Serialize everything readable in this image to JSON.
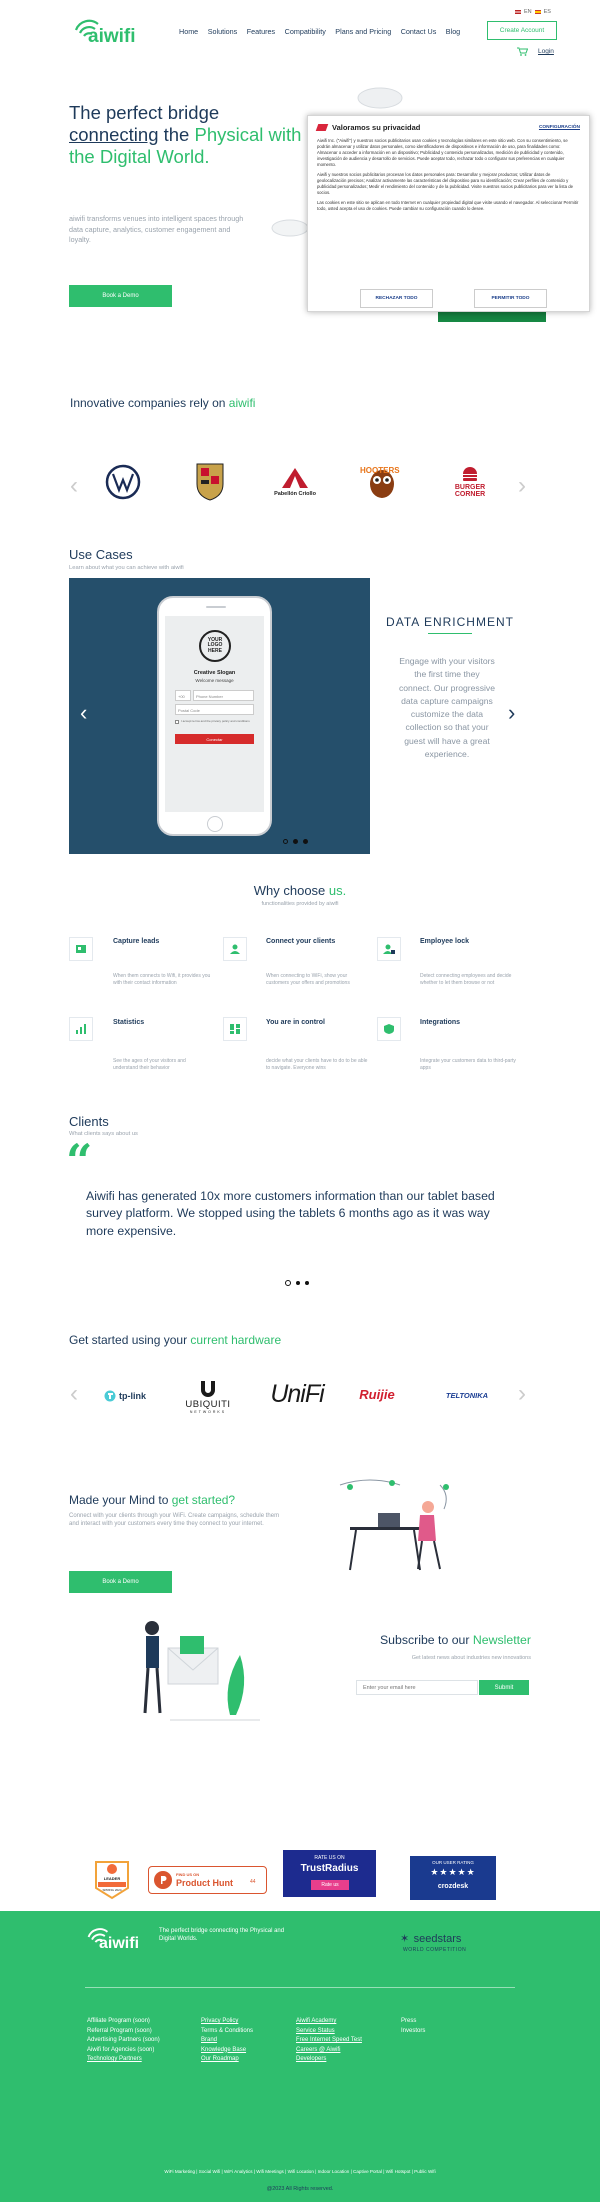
{
  "header": {
    "logo_text": "aiwifi",
    "lang": {
      "en": "EN",
      "es": "ES"
    },
    "nav": [
      "Home",
      "Solutions",
      "Features",
      "Compatibility",
      "Plans and Pricing",
      "Contact Us",
      "Blog"
    ],
    "create_account": "Create Account",
    "login": "Login"
  },
  "hero": {
    "title_line1": "The perfect bridge",
    "title_connecting": "connecting",
    "title_the": " the ",
    "title_physical": "Physical with",
    "title_line3": "the Digital World.",
    "description": "aiwifi transforms venues into intelligent spaces through data capture, analytics, customer engagement and loyalty.",
    "book_demo": "Book a Demo"
  },
  "cookie": {
    "title": "Valoramos su privacidad",
    "config": "CONFIGURACIÓN",
    "p1": "Aiwifi Inc. (\"Aiwifi\") y nuestros socios publicitarios usan cookies y tecnologías similares en este sitio web. Con su consentimiento, se podrán almacenar y utilizar datos personales, como identificadores de dispositivos e información de uso, para finalidades como: Almacenar o acceder a información en un dispositivo; Publicidad y contenido personalizados, medición de publicidad y contenido, investigación de audiencia y desarrollo de servicios. Puede aceptar todo, rechazar todo o configurar sus preferencias en cualquier momento.",
    "p2": "Aiwifi y nuestros socios publicitarios procesan los datos personales para: Desarrollar y mejorar productos; Utilizar datos de geolocalización precisos; Analizar activamente las características del dispositivo para su identificación; Crear perfiles de contenido y publicidad personalizados; Medir el rendimiento del contenido y de la publicidad. Visite nuestros socios publicitarios para ver la lista de socios.",
    "p3": "Las cookies en este sitio se aplican en todo Internet en cualquier propiedad digital que visite usando el navegador. Al seleccionar Permitir todo, usted acepta el uso de cookies. Puede cambiar su configuración cuando lo desee.",
    "reject": "RECHAZAR TODO",
    "accept": "PERMITIR TODO"
  },
  "companies": {
    "title_pre": "Innovative companies rely on ",
    "title_brand": "aiwifi",
    "logos": [
      "Volkswagen",
      "Porsche",
      "Pabellón Criollo",
      "Hooters",
      "Burger Corner"
    ]
  },
  "usecases": {
    "title": "Use Cases",
    "subtitle": "Learn about what you can achieve with aiwifi",
    "phone": {
      "logo": "YOUR LOGO HERE",
      "slogan": "Creative Slogan",
      "welcome": "Welcome message",
      "phone_prefix": "+00",
      "phone_placeholder": "Phone Number",
      "postal_placeholder": "Postal Code",
      "terms": "I accept terms and the privacy policy and conditions",
      "connect": "Conectar"
    },
    "slide_title": "DATA ENRICHMENT",
    "slide_text": "Engage with your visitors the first time they connect. Our progressive data capture campaigns customize the data collection so that your guest will have a great experience."
  },
  "why": {
    "title_pre": "Why choose ",
    "title_brand": "us.",
    "subtitle": "functionalities provided by aiwifi",
    "features": [
      {
        "title": "Capture leads",
        "desc": "When them connects to Wifi, it provides you with their contact information"
      },
      {
        "title": "Connect your clients",
        "desc": "When connecting to WiFi, show your customers your offers and promotions"
      },
      {
        "title": "Employee lock",
        "desc": "Detect connecting employees and decide whether to let them browse or not"
      },
      {
        "title": "Statistics",
        "desc": "See the ages of your visitors and understand their behavior"
      },
      {
        "title": "You are in control",
        "desc": "decide what your clients have to do to be able to navigate. Everyone wins"
      },
      {
        "title": "Integrations",
        "desc": "Integrate your customers data to third-party apps"
      }
    ]
  },
  "clients": {
    "title": "Clients",
    "subtitle": "What clients says about us",
    "quote": "Aiwifi has generated 10x more customers information than our tablet based survey platform. We stopped using the tablets 6 months ago as it was way more expensive."
  },
  "hardware": {
    "title_pre": "Get started using your ",
    "title_brand": "current hardware",
    "brands": [
      "tp-link",
      "UBIQUITI",
      "NETWORKS",
      "UniFi",
      "Ruijie",
      "TELTONIKA"
    ]
  },
  "mind": {
    "title_pre": "Made your Mind to ",
    "title_brand": "get started?",
    "desc": "Connect with your clients through your WiFi. Create campaigns, schedule them and interact with your customers every time they connect to your internet.",
    "book_demo": "Book a Demo"
  },
  "subscribe": {
    "title_pre": "Subscribe to our ",
    "title_brand": "Newsletter",
    "subtitle": "Get latest news about industries new innovations",
    "placeholder": "Enter your email here",
    "button": "Submit"
  },
  "badges": {
    "g2_top": "LEADER",
    "g2_bottom": "SPRING 2024",
    "ph_small": "FIND US ON",
    "ph_big": "Product Hunt",
    "ph_count": "44",
    "tr_small": "RATE US ON",
    "tr_big": "TrustRadius",
    "tr_btn": "Rate us",
    "cs_small": "OUR USER RATING",
    "cs_stars": "★★★★★",
    "cs_brand": "crozdesk"
  },
  "footer": {
    "logo_text": "aiwifi",
    "tagline": "The perfect bridge connecting the Physical and Digital Worlds.",
    "seedstars": "seedstars",
    "seedstars_sub": "WORLD COMPETITION",
    "col1": [
      "Affiliate Program (soon)",
      "Referral Program (soon)",
      "Advertising Partners (soon)",
      "Aiwifi for Agencies (soon)",
      "Technology Partners"
    ],
    "col2": [
      "Privacy Policy",
      "Terms & Conditions",
      "Brand",
      "Knowledge Base",
      "Our Roadmap"
    ],
    "col3": [
      "Aiwifi Academy",
      "Service Status",
      "Free Internet Speed Test",
      "Careers @ Aiwifi",
      "Developers"
    ],
    "col4": [
      "Press",
      "Investors"
    ],
    "seo_links": "WiFi Marketing | Social Wifi | WiFi Analytics | Wifi Meetings | Wifi Location | Indoor Location | Captive Portal | Wifi Hotspot | Public Wifi",
    "copyright": "@2023 All Rights reserved."
  },
  "colors": {
    "brand_green": "#2fbe6e",
    "navy": "#1e3a5a",
    "slide_bg": "#254f6b",
    "footer_bg": "#2fbe6e"
  }
}
